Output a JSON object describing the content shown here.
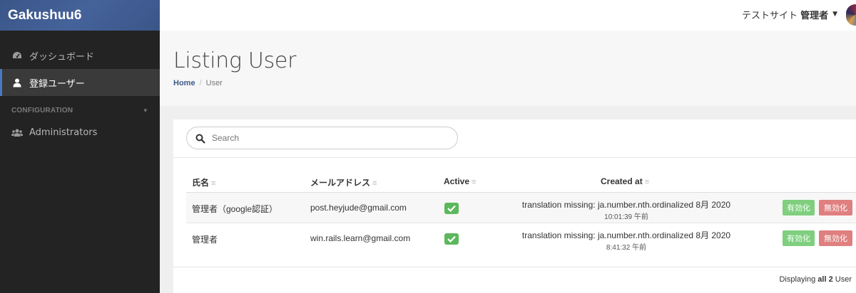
{
  "brand": "Gakushuu6",
  "sidebar": {
    "items": [
      {
        "label": "ダッシュボード",
        "icon": "dashboard-icon"
      },
      {
        "label": "登録ユーザー",
        "icon": "user-icon",
        "active": true
      }
    ],
    "section_header": "CONFIGURATION",
    "config_items": [
      {
        "label": "Administrators",
        "icon": "users-icon"
      }
    ]
  },
  "topbar": {
    "site_name": "テストサイト",
    "user_name": "管理者"
  },
  "page": {
    "title": "Listing User",
    "breadcrumb": {
      "home": "Home",
      "current": "User"
    }
  },
  "search": {
    "placeholder": "Search"
  },
  "table": {
    "columns": [
      "氏名",
      "メールアドレス",
      "Active",
      "Created at"
    ],
    "sort_glyph": "≡",
    "rows": [
      {
        "name": "管理者（google認証）",
        "email": "post.heyjude@gmail.com",
        "active": true,
        "created_date": "translation missing: ja.number.nth.ordinalized 8月 2020",
        "created_time": "10:01:39 午前",
        "enable_label": "有効化",
        "disable_label": "無効化"
      },
      {
        "name": "管理者",
        "email": "win.rails.learn@gmail.com",
        "active": true,
        "created_date": "translation missing: ja.number.nth.ordinalized 8月 2020",
        "created_time": "8:41:32 午前",
        "enable_label": "有効化",
        "disable_label": "無効化"
      }
    ]
  },
  "footer": {
    "prefix": "Displaying",
    "count": "all 2",
    "suffix": "User"
  },
  "colors": {
    "brand_bg": "#3c5a8a",
    "sidebar_bg": "#232323",
    "active_green": "#5cb85c",
    "enable_green": "#7fcf7f",
    "disable_red": "#e07f7f"
  }
}
